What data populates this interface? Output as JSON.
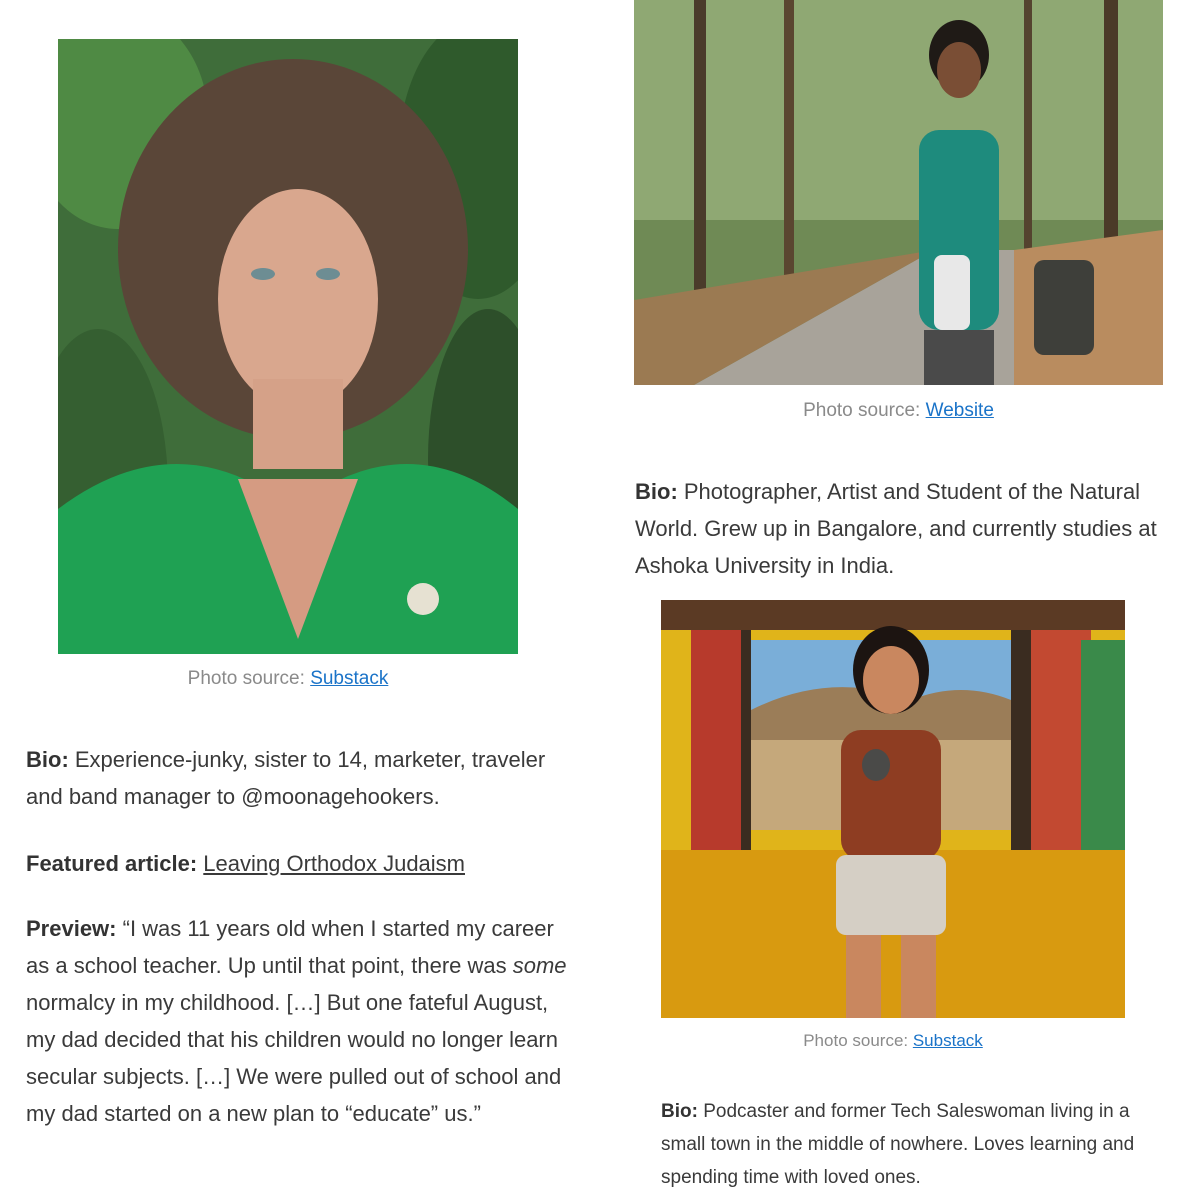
{
  "left": {
    "caption_prefix": "Photo source: ",
    "caption_link": "Substack",
    "bio_label": "Bio:",
    "bio_text": " Experience-junky, sister to 14, marketer, traveler and band manager to @moonagehookers.",
    "featured_label": "Featured article:",
    "featured_link": "Leaving Orthodox Judaism",
    "preview_label": "Preview:",
    "preview_text_1": " “I was 11 years old when I started my career as a school teacher. Up until that point, there was ",
    "preview_emph": "some",
    "preview_text_2": " normalcy in my childhood. […] But one fateful August, my dad decided that his children would no longer learn secular subjects. […] We were pulled out of school and my dad started on a new plan to “educate” us.”"
  },
  "right_top": {
    "caption_prefix": "Photo source: ",
    "caption_link": "Website",
    "bio_label": "Bio:",
    "bio_text": " Photographer, Artist and Student of the Natural World. Grew up in Bangalore, and currently studies at Ashoka University in India."
  },
  "right_bottom": {
    "caption_prefix": "Photo source: ",
    "caption_link": "Substack",
    "bio_label": "Bio:",
    "bio_text": " Podcaster and former Tech Saleswoman living in a small town in the middle of nowhere. Loves learning and spending time with loved ones."
  },
  "colors": {
    "link_blue": "#1a73c8",
    "caption_gray": "#8a8a8a",
    "text": "#3a3a3a"
  }
}
